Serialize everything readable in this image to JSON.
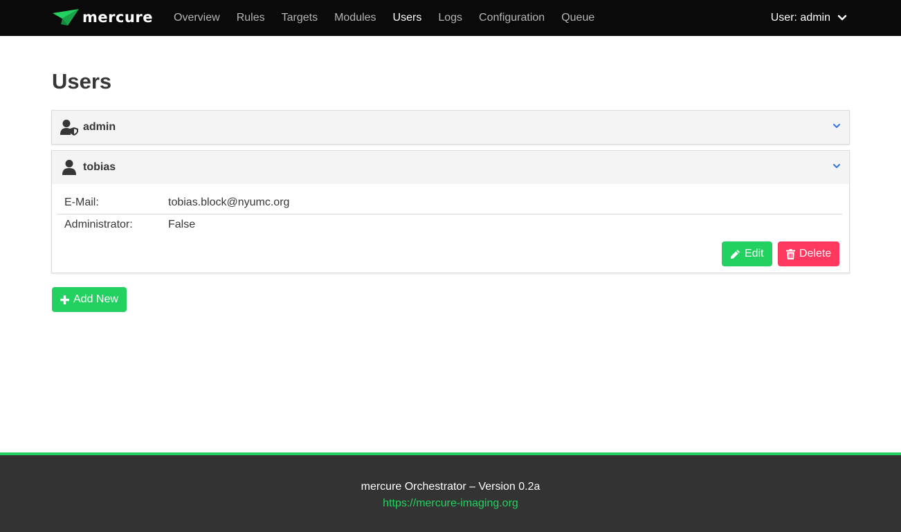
{
  "brand": {
    "name": "mercure",
    "logo_icon": "paper-plane-icon"
  },
  "nav": {
    "items": [
      {
        "label": "Overview"
      },
      {
        "label": "Rules"
      },
      {
        "label": "Targets"
      },
      {
        "label": "Modules"
      },
      {
        "label": "Users",
        "active": true
      },
      {
        "label": "Logs"
      },
      {
        "label": "Configuration"
      },
      {
        "label": "Queue"
      }
    ],
    "user_menu": {
      "label": "User: admin",
      "icon": "chevron-down-icon"
    }
  },
  "page": {
    "title": "Users"
  },
  "users": [
    {
      "name": "admin",
      "icon": "user-shield-icon",
      "expanded": false
    },
    {
      "name": "tobias",
      "icon": "user-icon",
      "expanded": true,
      "fields": [
        {
          "label": "E-Mail:",
          "value": "tobias.block@nyumc.org"
        },
        {
          "label": "Administrator:",
          "value": "False"
        }
      ],
      "buttons": {
        "edit": "Edit",
        "delete": "Delete"
      }
    }
  ],
  "actions": {
    "add_new": "Add New"
  },
  "footer": {
    "version_text": "mercure Orchestrator – Version 0.2a",
    "link": "https://mercure-imaging.org"
  },
  "colors": {
    "navbar": "#0a0a0a",
    "accent_green": "#23d160",
    "danger": "#ff3860",
    "footer": "#333333",
    "chevron": "#3273dc"
  }
}
